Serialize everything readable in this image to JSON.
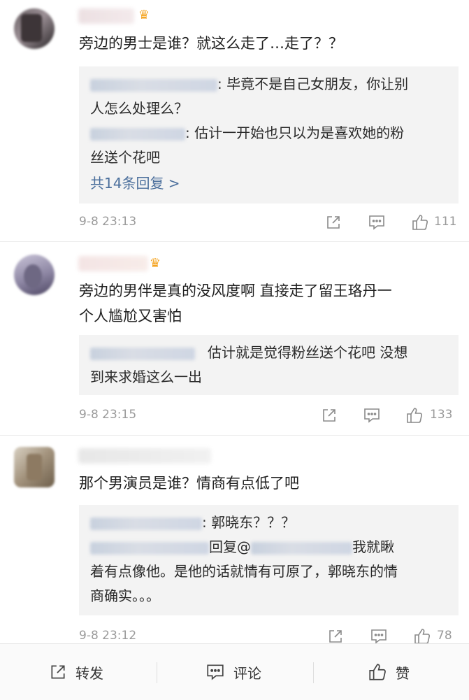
{
  "comments": [
    {
      "text": "旁边的男士是谁？就这么走了…走了？？",
      "replies": [
        {
          "text": ": 毕竟不是自己女朋友，你让别",
          "cont": "人怎么处理么？"
        },
        {
          "text": ": 估计一开始也只以为是喜欢她的粉",
          "cont": "丝送个花吧"
        }
      ],
      "more": "共14条回复 >",
      "time": "9-8 23:13",
      "likes": "111"
    },
    {
      "text_line1": "旁边的男伴是真的没风度啊 直接走了留王珞丹一",
      "text_line2": "个人尴尬又害怕",
      "replies": [
        {
          "text": "估计就是觉得粉丝送个花吧  没想",
          "cont": "到来求婚这么一出"
        }
      ],
      "time": "9-8 23:15",
      "likes": "133"
    },
    {
      "text": "那个男演员是谁？情商有点低了吧",
      "replies": [
        {
          "text": ": 郭晓东？？？"
        },
        {
          "text_pre": "回复@",
          "text_post": "我就瞅",
          "cont1": "着有点像他。是他的话就情有可原了，郭晓东的情",
          "cont2": "商确实。。。"
        }
      ],
      "time": "9-8 23:12",
      "likes": "78"
    }
  ],
  "bottom_bar": {
    "repost": "转发",
    "comment": "评论",
    "like": "赞"
  },
  "icons": {
    "share": "share-icon",
    "comment": "comment-icon",
    "like": "thumbs-up-icon",
    "vip": "crown-icon"
  }
}
